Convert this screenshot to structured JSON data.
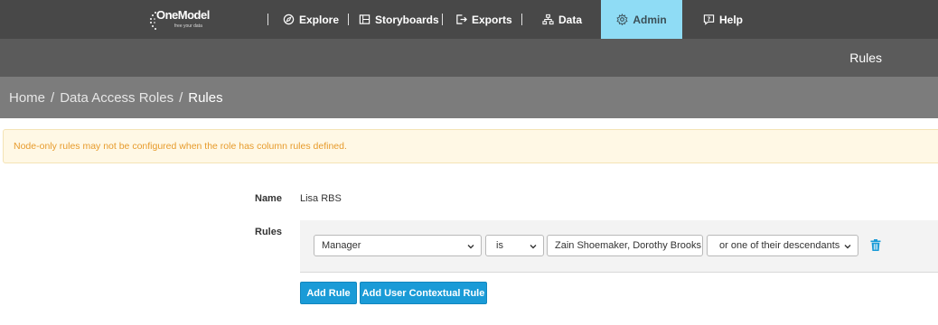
{
  "brand": {
    "name": "OneModel",
    "tagline": "free your data"
  },
  "nav": {
    "items": [
      {
        "label": "Explore"
      },
      {
        "label": "Storyboards"
      },
      {
        "label": "Exports"
      },
      {
        "label": "Data"
      },
      {
        "label": "Admin",
        "active": true
      },
      {
        "label": "Help"
      }
    ]
  },
  "page": {
    "title": "Rules"
  },
  "breadcrumb": {
    "home": "Home",
    "sep": "/",
    "roles": "Data Access Roles",
    "current": "Rules"
  },
  "warning": {
    "text": "Node-only rules may not be configured when the role has column rules defined."
  },
  "form": {
    "name_label": "Name",
    "name_value": "Lisa RBS",
    "rules_label": "Rules",
    "rule": {
      "field": "Manager",
      "operator": "is",
      "values": "Zain Shoemaker, Dorothy Brooks",
      "scope": "or one of their descendants"
    },
    "add_rule": "Add Rule",
    "add_contextual_rule": "Add User Contextual Rule"
  },
  "colors": {
    "accent": "#1a9bd7",
    "active_nav": "#8fdcf5",
    "warning_text": "#e79b2c",
    "trash": "#1a9bd7"
  }
}
